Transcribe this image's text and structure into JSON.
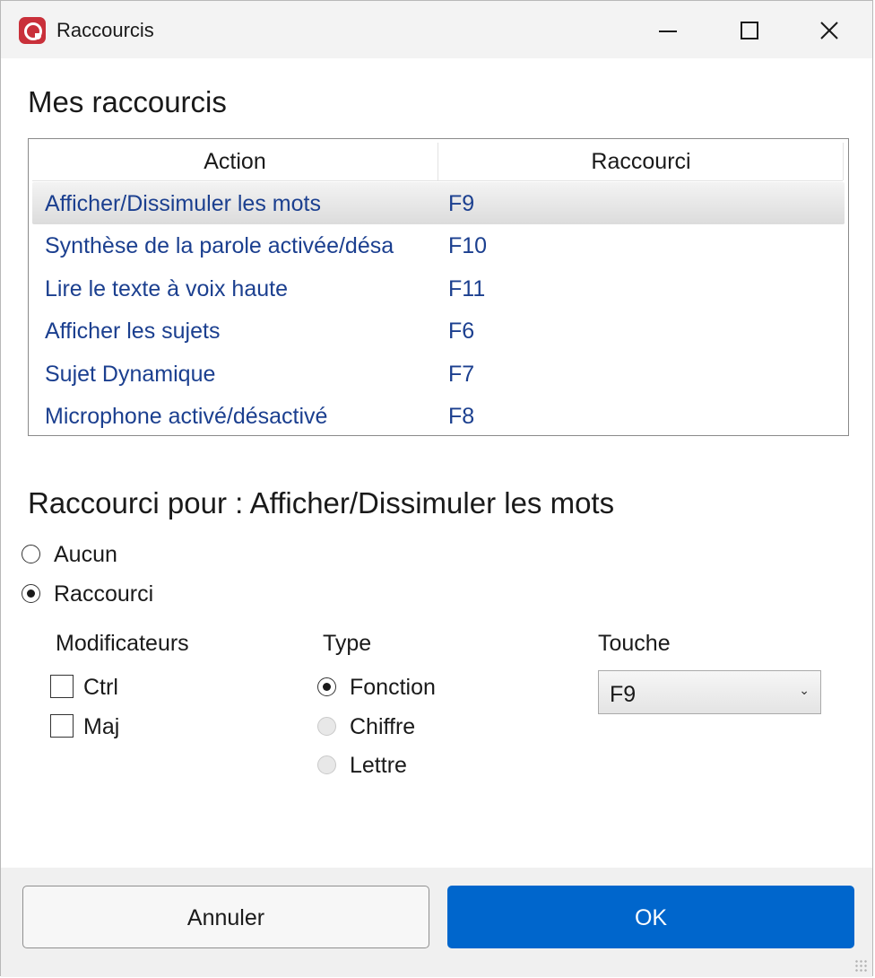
{
  "window": {
    "title": "Raccourcis"
  },
  "shortcuts_section": {
    "heading": "Mes raccourcis",
    "columns": [
      "Action",
      "Raccourci"
    ],
    "rows": [
      {
        "action": "Afficher/Dissimuler les mots",
        "key": "F9",
        "selected": true
      },
      {
        "action": "Synthèse de la parole activée/désa",
        "key": "F10",
        "selected": false
      },
      {
        "action": "Lire le texte à voix haute",
        "key": "F11",
        "selected": false
      },
      {
        "action": "Afficher les sujets",
        "key": "F6",
        "selected": false
      },
      {
        "action": "Sujet Dynamique",
        "key": "F7",
        "selected": false
      },
      {
        "action": "Microphone activé/désactivé",
        "key": "F8",
        "selected": false
      }
    ]
  },
  "editor": {
    "heading": "Raccourci pour : Afficher/Dissimuler les mots",
    "mode_none": "Aucun",
    "mode_shortcut": "Raccourci",
    "modifiers_label": "Modificateurs",
    "ctrl_label": "Ctrl",
    "maj_label": "Maj",
    "type_label": "Type",
    "type_function": "Fonction",
    "type_digit": "Chiffre",
    "type_letter": "Lettre",
    "key_label": "Touche",
    "key_value": "F9"
  },
  "footer": {
    "cancel_label": "Annuler",
    "ok_label": "OK"
  },
  "colors": {
    "accent": "#0066cc",
    "row_text": "#1b3f8f",
    "app_icon": "#c9303a"
  }
}
